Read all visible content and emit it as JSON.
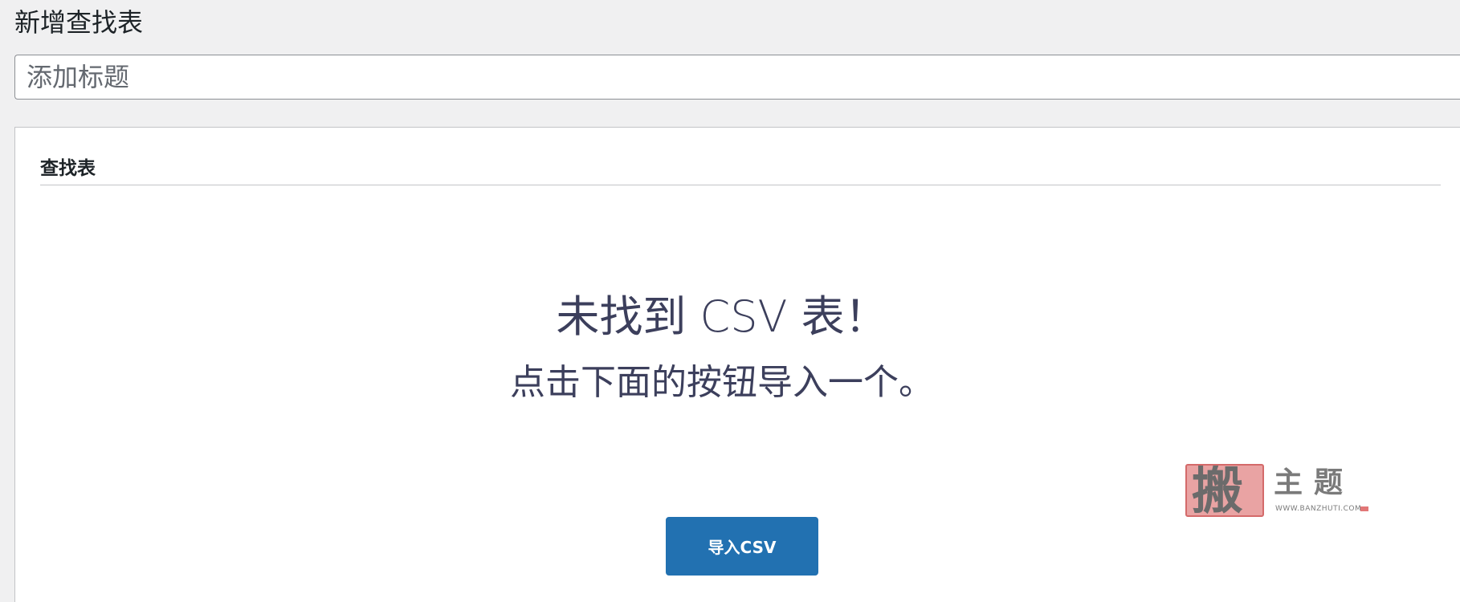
{
  "page": {
    "title": "新增查找表"
  },
  "title_field": {
    "placeholder": "添加标题",
    "value": ""
  },
  "postbox": {
    "title": "查找表",
    "empty_state": {
      "heading": "未找到 CSV 表！",
      "subheading": "点击下面的按钮导入一个。"
    },
    "import_button_label": "导入CSV"
  },
  "watermark": {
    "seal_char": "搬",
    "text": "主题",
    "url": "WWW.BANZHUTI.COM"
  },
  "colors": {
    "background": "#f0f0f1",
    "panel": "#ffffff",
    "primary_button": "#2271b1",
    "empty_text": "#3c3f5c"
  }
}
